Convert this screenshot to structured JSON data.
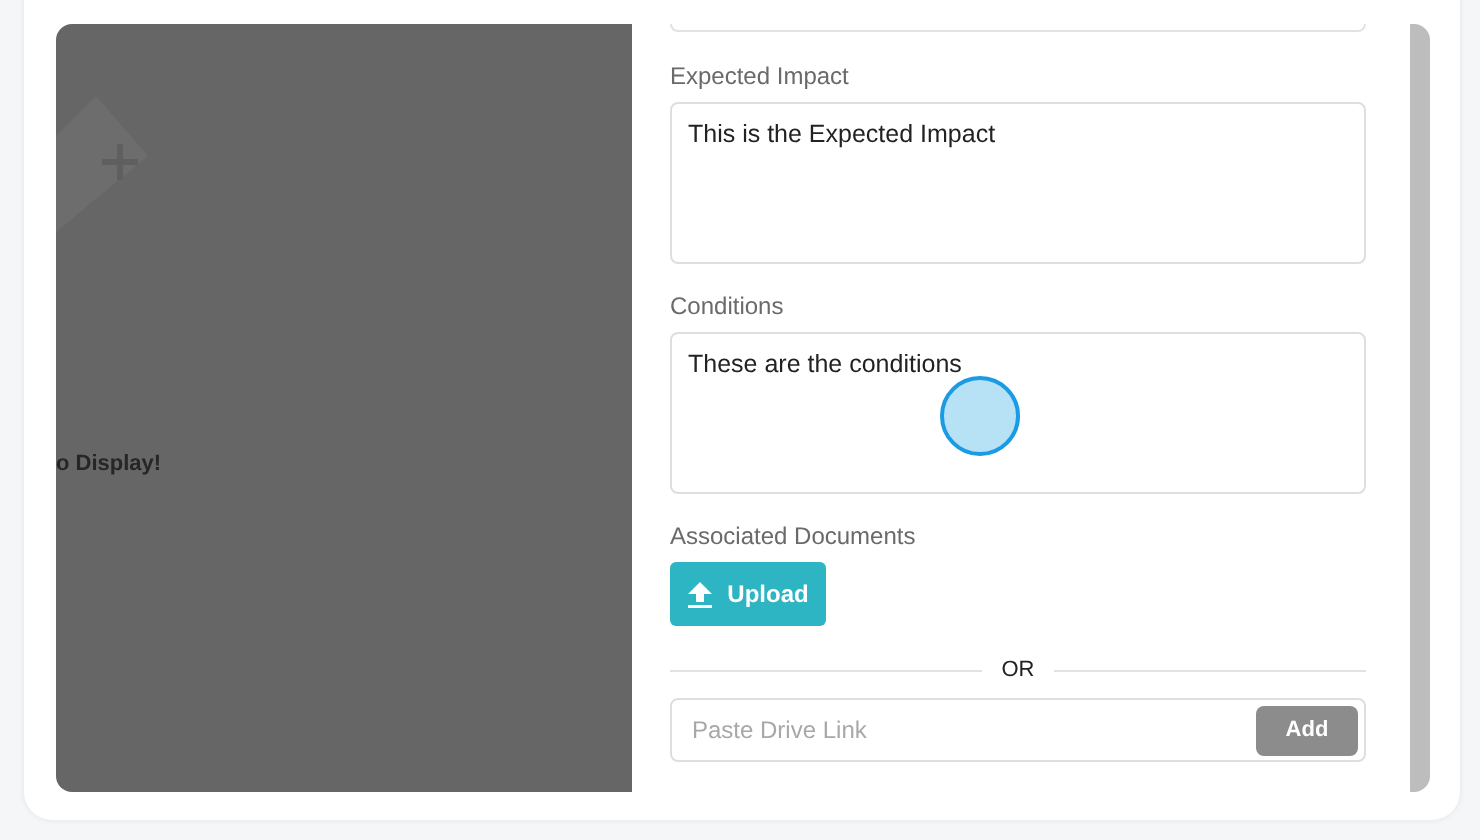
{
  "background": {
    "empty_text": "o Display!"
  },
  "form": {
    "fields": [
      {
        "label": "Expected Impact",
        "value": "This is the Expected Impact"
      },
      {
        "label": "Conditions",
        "value": "These are the conditions"
      }
    ],
    "documents": {
      "label": "Associated Documents",
      "upload_button": "Upload",
      "divider": "OR",
      "link_field": {
        "placeholder": "Paste Drive Link"
      },
      "add_button": {
        "label": "Add",
        "disabled": true
      }
    }
  }
}
